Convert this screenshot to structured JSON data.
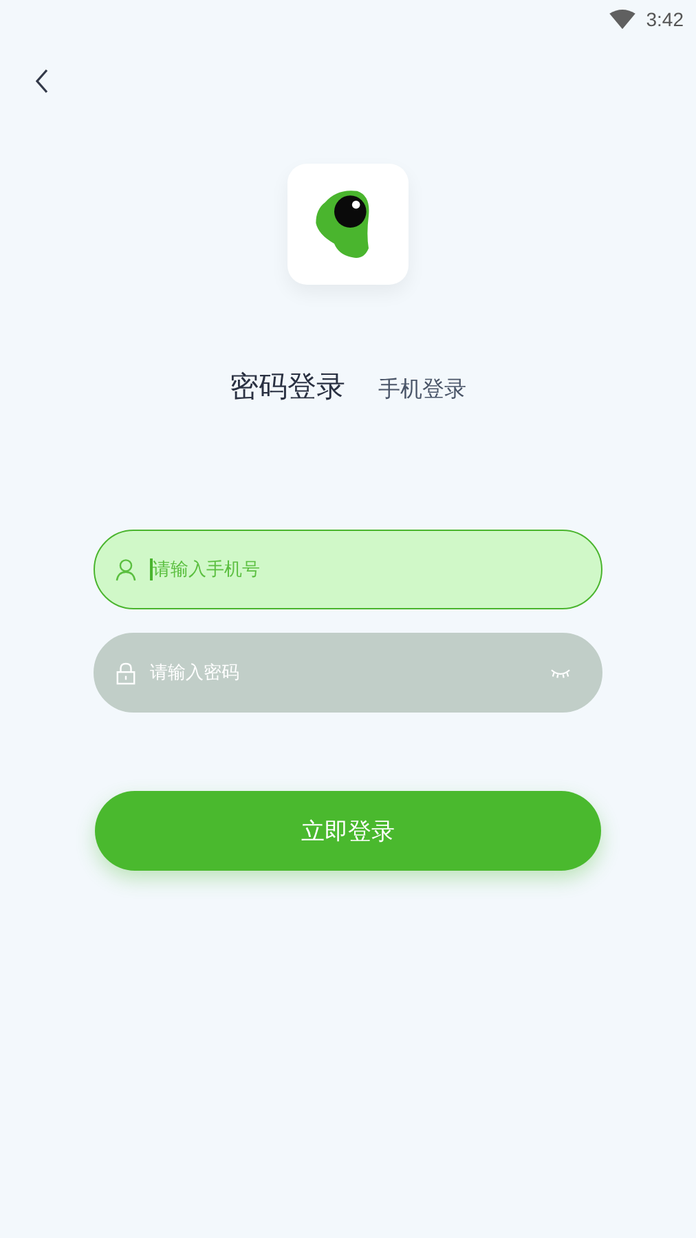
{
  "status_bar": {
    "time": "3:42"
  },
  "tabs": [
    {
      "label": "密码登录",
      "selected": true
    },
    {
      "label": "手机登录",
      "selected": false
    }
  ],
  "fields": [
    {
      "kind": "phone",
      "placeholder": "请输入手机号",
      "focused": true
    },
    {
      "kind": "password",
      "placeholder": "请输入密码",
      "focused": false
    }
  ],
  "login_button": {
    "label": "立即登录"
  }
}
